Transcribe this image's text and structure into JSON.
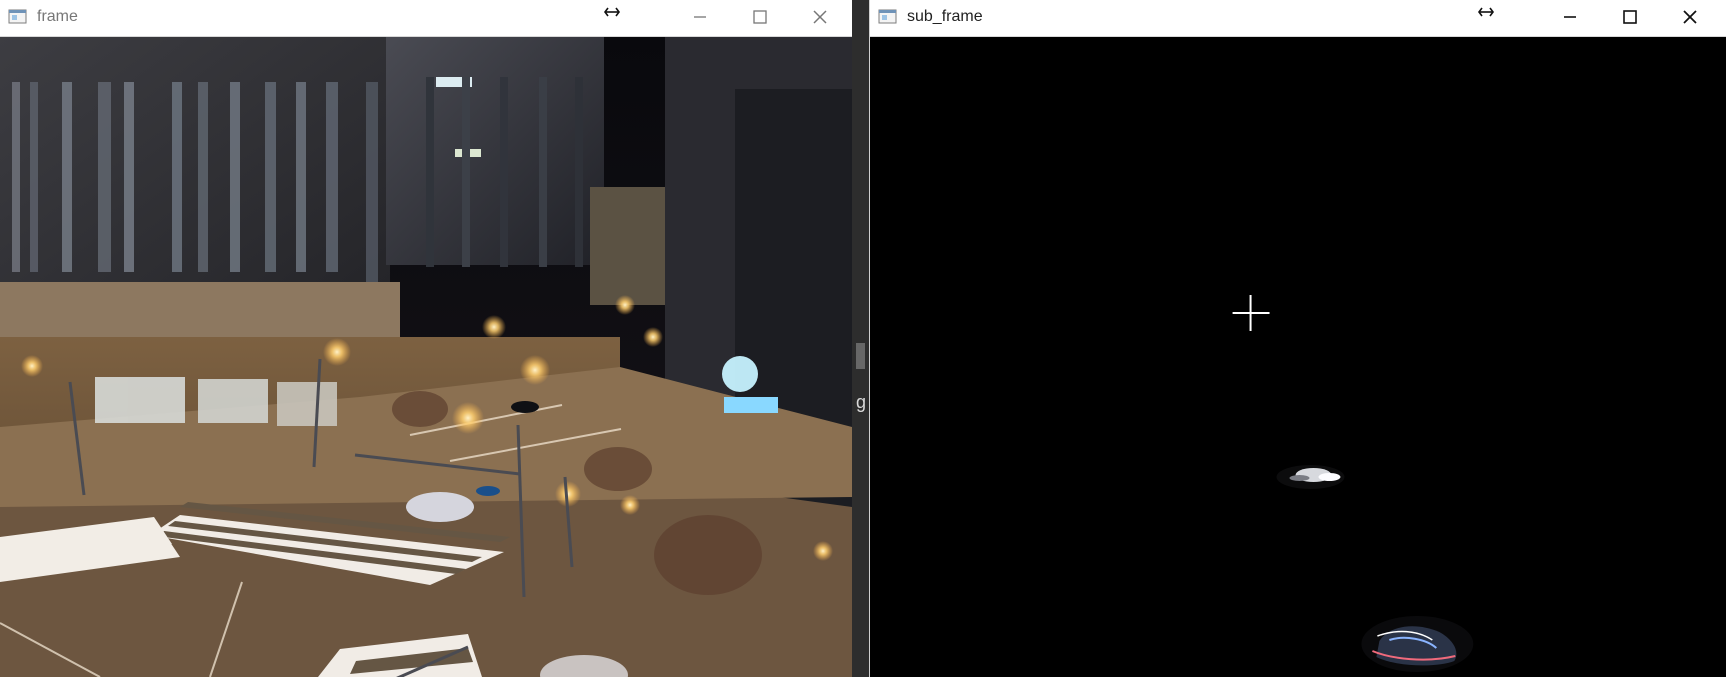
{
  "windows": {
    "left": {
      "title": "frame",
      "icon": "window-app-icon",
      "resize_icon": "resize-horizontal-icon",
      "controls": [
        "minimize-icon",
        "maximize-icon",
        "close-icon"
      ]
    },
    "right": {
      "title": "sub_frame",
      "icon": "window-app-icon",
      "resize_icon": "resize-horizontal-icon",
      "controls": [
        "minimize-icon",
        "maximize-icon",
        "close-icon"
      ],
      "cursor_icon": "crosshair-cursor-icon"
    }
  },
  "gap": {
    "edge_letter": "g"
  },
  "colors": {
    "titlebar_bg": "#ffffff",
    "window_border": "#d8d8d8",
    "night_sky": "#101014",
    "street": "#5b4a38",
    "light_glow": "#ffd58a",
    "subtracted_bg": "#000000",
    "cursor": "#ffffff"
  }
}
